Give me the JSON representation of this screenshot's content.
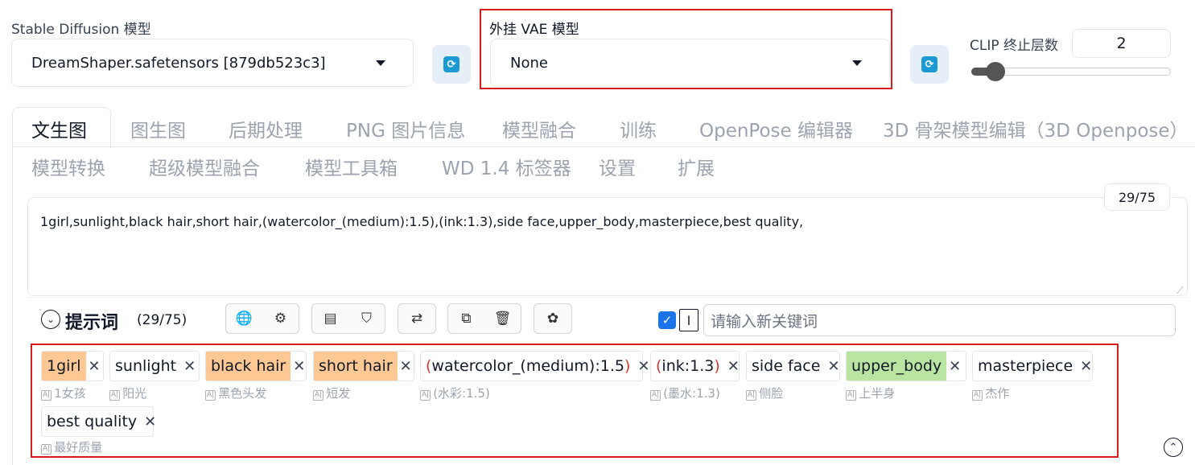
{
  "model": {
    "label": "Stable Diffusion 模型",
    "value": "DreamShaper.safetensors [879db523c3]"
  },
  "vae": {
    "label": "外挂 VAE 模型",
    "value": "None"
  },
  "clip": {
    "label": "CLIP 终止层数",
    "value": "2",
    "slider_fraction": 0.04
  },
  "tabs": [
    "文生图",
    "图生图",
    "后期处理",
    "PNG 图片信息",
    "模型融合",
    "训练",
    "OpenPose 编辑器",
    "3D 骨架模型编辑（3D Openpose）",
    "模型转换",
    "超级模型融合",
    "模型工具箱",
    "WD 1.4 标签器",
    "设置",
    "扩展"
  ],
  "prompt": {
    "text": "1girl,sunlight,black hair,short hair,(watercolor_(medium):1.5),(ink:1.3),side face,upper_body,masterpiece,best quality,",
    "counter": "29/75"
  },
  "toolbar": {
    "title": "提示词",
    "count": "(29/75)",
    "keyword_placeholder": "请输入新关键词"
  },
  "tags": [
    {
      "text": "1girl",
      "translation": "1女孩"
    },
    {
      "text": "sunlight",
      "translation": "阳光"
    },
    {
      "text": "black hair",
      "translation": "黑色头发"
    },
    {
      "text": "short hair",
      "translation": "短发"
    },
    {
      "open": "(",
      "text": "watercolor_(medium):1.5",
      "close": ")",
      "translation": "(水彩:1.5)"
    },
    {
      "open": "(",
      "text": "ink:1.3",
      "close": ")",
      "translation": "(墨水:1.3)"
    },
    {
      "text": "side face",
      "translation": "侧脸"
    },
    {
      "text": "upper_body",
      "translation": "上半身"
    },
    {
      "text": "masterpiece",
      "translation": "杰作"
    },
    {
      "text": "best quality",
      "translation": "最好质量"
    }
  ],
  "colors": {
    "highlight_box": "#d71a1a",
    "tag_orange": "#fdc893",
    "tag_green": "#b9e4a1",
    "refresh_blue": "#1c9ad6",
    "checkbox_blue": "#1a73e8"
  },
  "icons": [
    "refresh-icon",
    "chevron-down-icon",
    "globe-icon",
    "gear-icon",
    "history-icon",
    "bookmark-icon",
    "translate-icon",
    "copy-icon",
    "trash-icon",
    "openai-icon",
    "checkbox-icon",
    "text-cursor-icon",
    "close-icon",
    "collapse-up-icon"
  ]
}
